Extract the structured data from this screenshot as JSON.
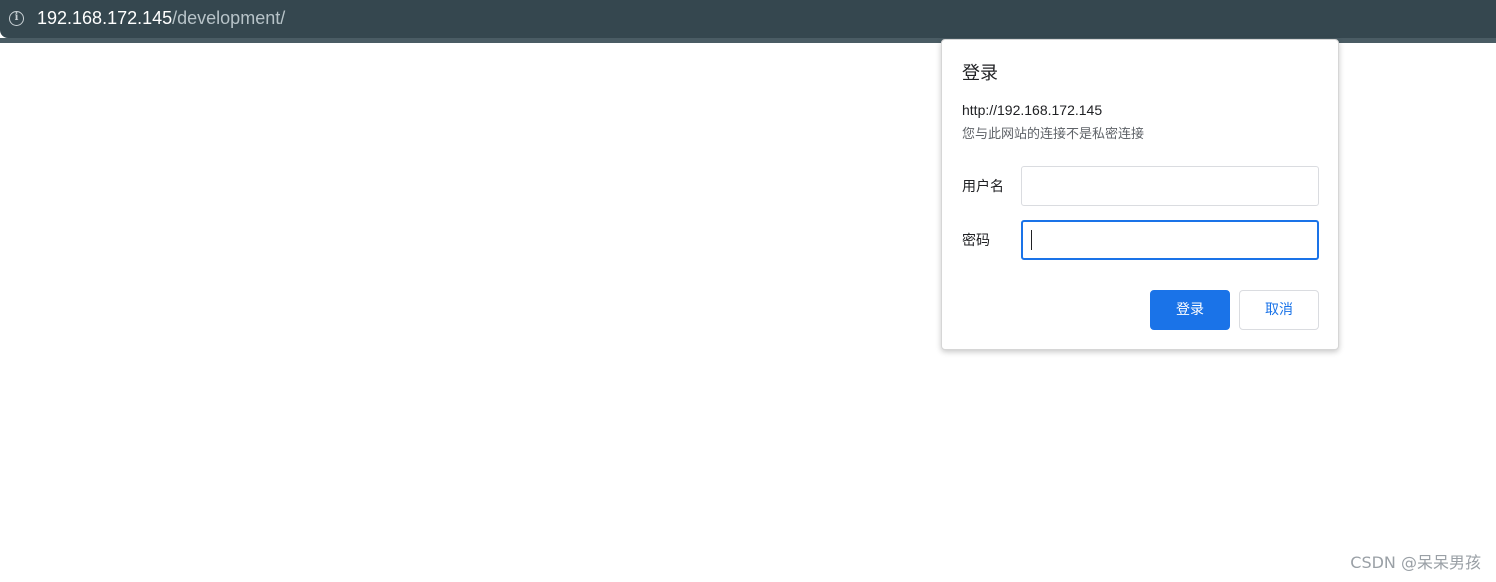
{
  "browser": {
    "url_host": "192.168.172.145",
    "url_path": "/development/",
    "info_icon": "info-icon"
  },
  "dialog": {
    "title": "登录",
    "origin": "http://192.168.172.145",
    "warning": "您与此网站的连接不是私密连接",
    "username_label": "用户名",
    "username_value": "",
    "password_label": "密码",
    "password_value": "",
    "login_button": "登录",
    "cancel_button": "取消"
  },
  "colors": {
    "toolbar": "#35474f",
    "accent": "#1a73e8"
  },
  "watermark": "CSDN @呆呆男孩"
}
